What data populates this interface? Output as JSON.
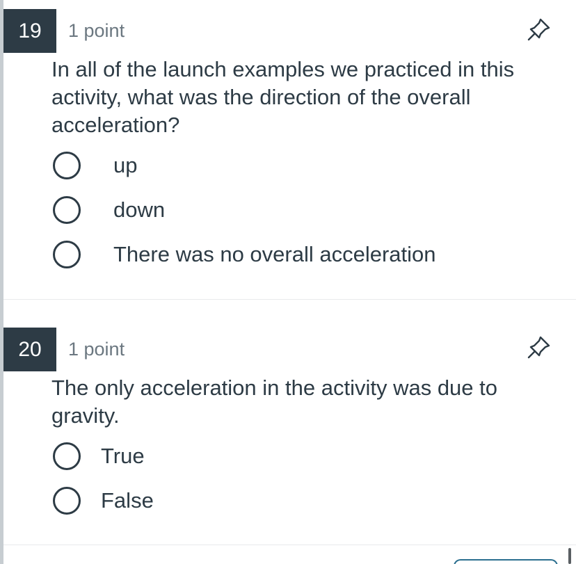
{
  "questions": [
    {
      "number": "19",
      "points": "1 point",
      "text": "In all of the launch examples we practiced in this activity, what was the direction of the overall acceleration?",
      "answers": [
        "up",
        "down",
        "There was no overall acceleration"
      ],
      "pin_icon": "pin-icon"
    },
    {
      "number": "20",
      "points": "1 point",
      "text": "The only acceleration in the activity was due to gravity.",
      "answers": [
        "True",
        "False"
      ],
      "pin_icon": "pin-icon"
    }
  ],
  "colors": {
    "number_badge_bg": "#2d3b45",
    "text": "#2d3b45",
    "muted_text": "#6b7780",
    "divider": "#e8eaec",
    "left_edge": "#c7cdd1"
  }
}
